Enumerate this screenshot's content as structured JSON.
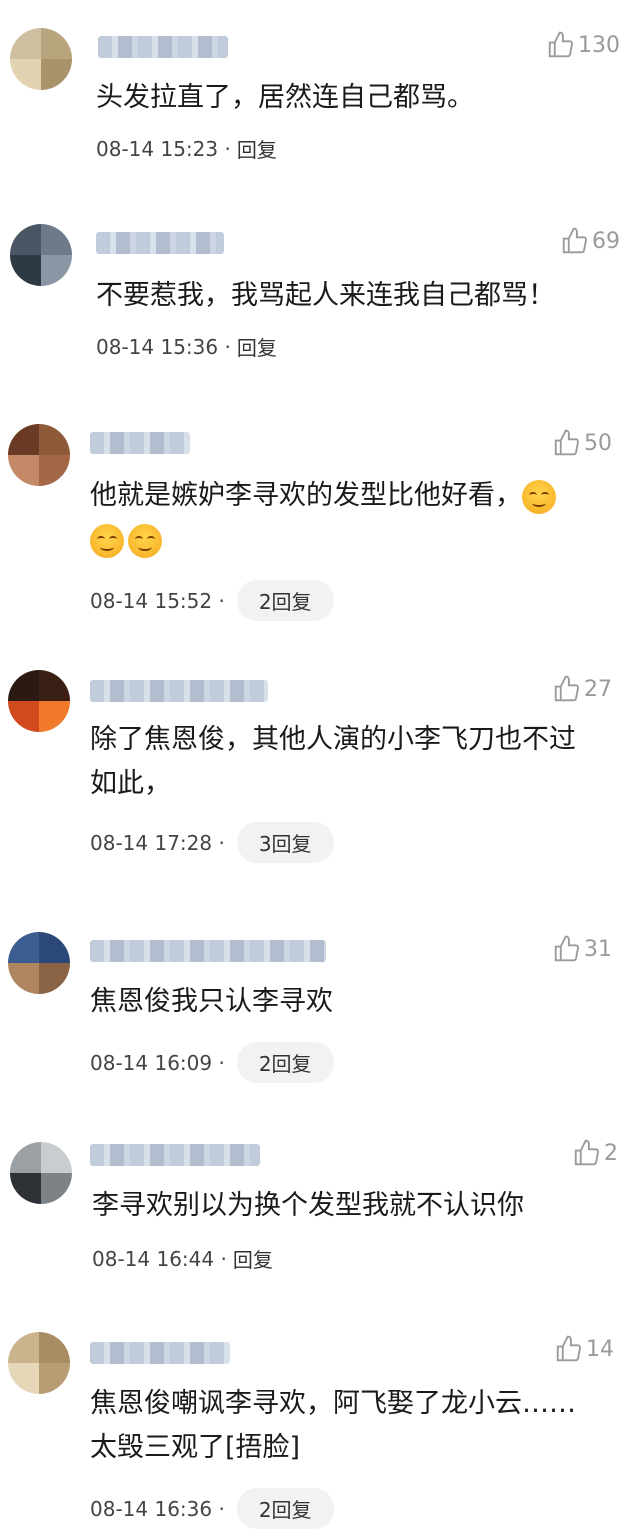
{
  "comments": [
    {
      "likes": "130",
      "text": "头发拉直了，居然连自己都骂。",
      "time": "08-14 15:23 ·",
      "reply": "回复"
    },
    {
      "likes": "69",
      "text": "不要惹我，我骂起人来连我自己都骂！",
      "time": "08-14 15:36 ·",
      "reply": "回复"
    },
    {
      "likes": "50",
      "text": "他就是嫉妒李寻欢的发型比他好看，",
      "time": "08-14 15:52 ·",
      "reply": "2回复"
    },
    {
      "likes": "27",
      "text": "除了焦恩俊，其他人演的小李飞刀也不过如此，",
      "time": "08-14 17:28 ·",
      "reply": "3回复"
    },
    {
      "likes": "31",
      "text": "焦恩俊我只认李寻欢",
      "time": "08-14 16:09 ·",
      "reply": "2回复"
    },
    {
      "likes": "2",
      "text": "李寻欢别以为换个发型我就不认识你",
      "time": "08-14 16:44 ·",
      "reply": "回复"
    },
    {
      "likes": "14",
      "text": "焦恩俊嘲讽李寻欢，阿飞娶了龙小云……太毁三观了[捂脸]",
      "time": "08-14 16:36 ·",
      "reply": "2回复"
    }
  ],
  "colors": {
    "like": "#9a9a9a",
    "pill_bg": "#f2f2f2"
  },
  "icons": {
    "like": "thumbs-up-icon",
    "emoji": "smile-emoji-icon"
  }
}
